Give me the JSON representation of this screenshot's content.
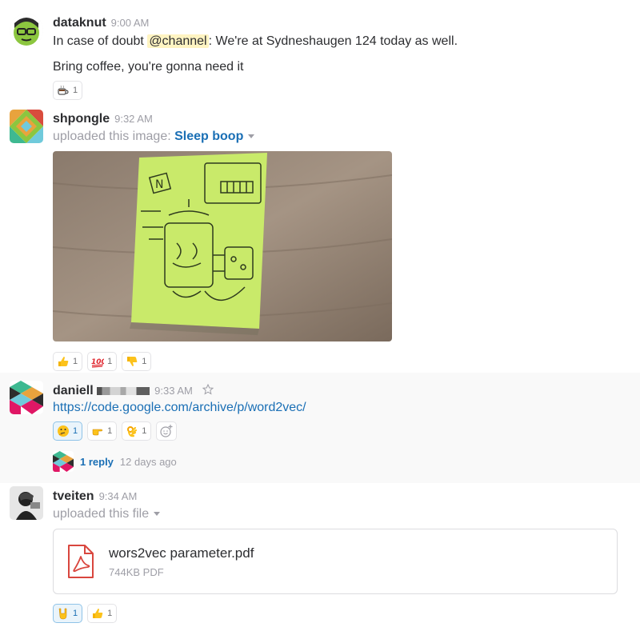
{
  "messages": [
    {
      "user": "dataknut",
      "time": "9:00 AM",
      "text_prefix": "In case of doubt ",
      "mention": "@channel",
      "text_suffix": ": We're at Sydneshaugen 124 today as well.",
      "text2": "Bring coffee, you're gonna need it",
      "reactions": [
        {
          "emoji": "coffee-icon",
          "count": "1"
        }
      ]
    },
    {
      "user": "shpongle",
      "time": "9:32 AM",
      "upload_label": "uploaded this image: ",
      "file_title": "Sleep boop",
      "reactions": [
        {
          "emoji": "thumbs-up-icon",
          "count": "1"
        },
        {
          "emoji": "hundred-icon",
          "count": "1"
        },
        {
          "emoji": "thumbs-down-icon",
          "count": "1"
        }
      ]
    },
    {
      "user": "daniell",
      "time": "9:33 AM",
      "link": "https://code.google.com/archive/p/word2vec/",
      "reactions": [
        {
          "emoji": "thinking-face-icon",
          "count": "1"
        },
        {
          "emoji": "pointing-right-icon",
          "count": "1"
        },
        {
          "emoji": "ok-hand-icon",
          "count": "1"
        }
      ],
      "thread": {
        "replies": "1 reply",
        "ago": "12 days ago"
      }
    },
    {
      "user": "tveiten",
      "time": "9:34 AM",
      "upload_label": "uploaded this file",
      "file": {
        "name": "wors2vec parameter.pdf",
        "meta": "744KB PDF"
      },
      "reactions": [
        {
          "emoji": "rock-on-icon",
          "count": "1"
        },
        {
          "emoji": "thumbs-up-icon",
          "count": "1"
        }
      ]
    }
  ],
  "colors": {
    "link": "#1a6fb5",
    "mention_bg": "#fff4c2",
    "pdf_red": "#d9463e",
    "note_green": "#c9ea6a"
  }
}
